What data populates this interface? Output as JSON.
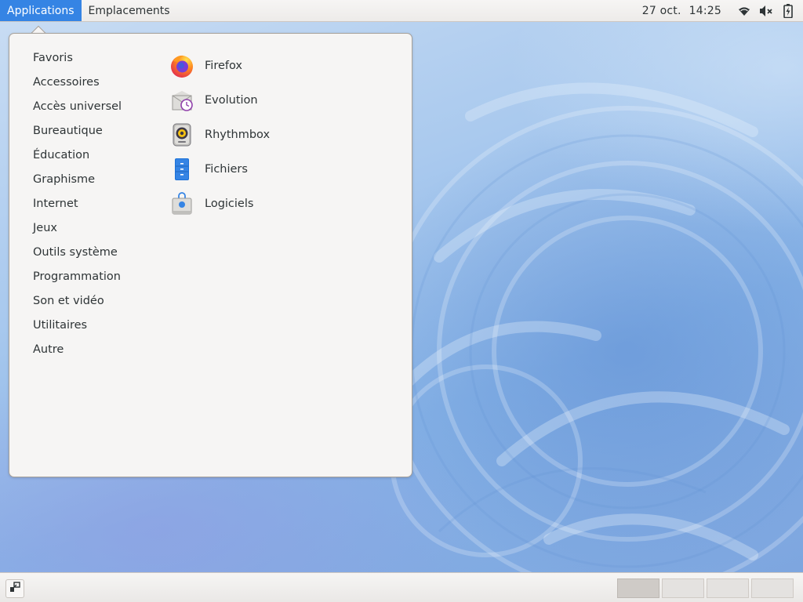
{
  "topbar": {
    "applications_label": "Applications",
    "places_label": "Emplacements",
    "date": "27 oct.",
    "time": "14:25",
    "icons": [
      "wifi-icon",
      "volume-muted-icon",
      "battery-charging-icon"
    ]
  },
  "menu": {
    "categories": [
      {
        "label": "Favoris"
      },
      {
        "label": "Accessoires"
      },
      {
        "label": "Accès universel"
      },
      {
        "label": "Bureautique"
      },
      {
        "label": "Éducation"
      },
      {
        "label": "Graphisme"
      },
      {
        "label": "Internet"
      },
      {
        "label": "Jeux"
      },
      {
        "label": "Outils système"
      },
      {
        "label": "Programmation"
      },
      {
        "label": "Son et vidéo"
      },
      {
        "label": "Utilitaires"
      },
      {
        "label": "Autre"
      }
    ],
    "apps": [
      {
        "label": "Firefox",
        "icon": "firefox-icon"
      },
      {
        "label": "Evolution",
        "icon": "evolution-icon"
      },
      {
        "label": "Rhythmbox",
        "icon": "rhythmbox-icon"
      },
      {
        "label": "Fichiers",
        "icon": "files-icon"
      },
      {
        "label": "Logiciels",
        "icon": "software-icon"
      }
    ]
  },
  "bottombar": {
    "workspace_count": 4,
    "active_workspace": 1
  },
  "colors": {
    "accent": "#3584e4",
    "panel": "#f6f5f4",
    "text": "#2e3436"
  }
}
